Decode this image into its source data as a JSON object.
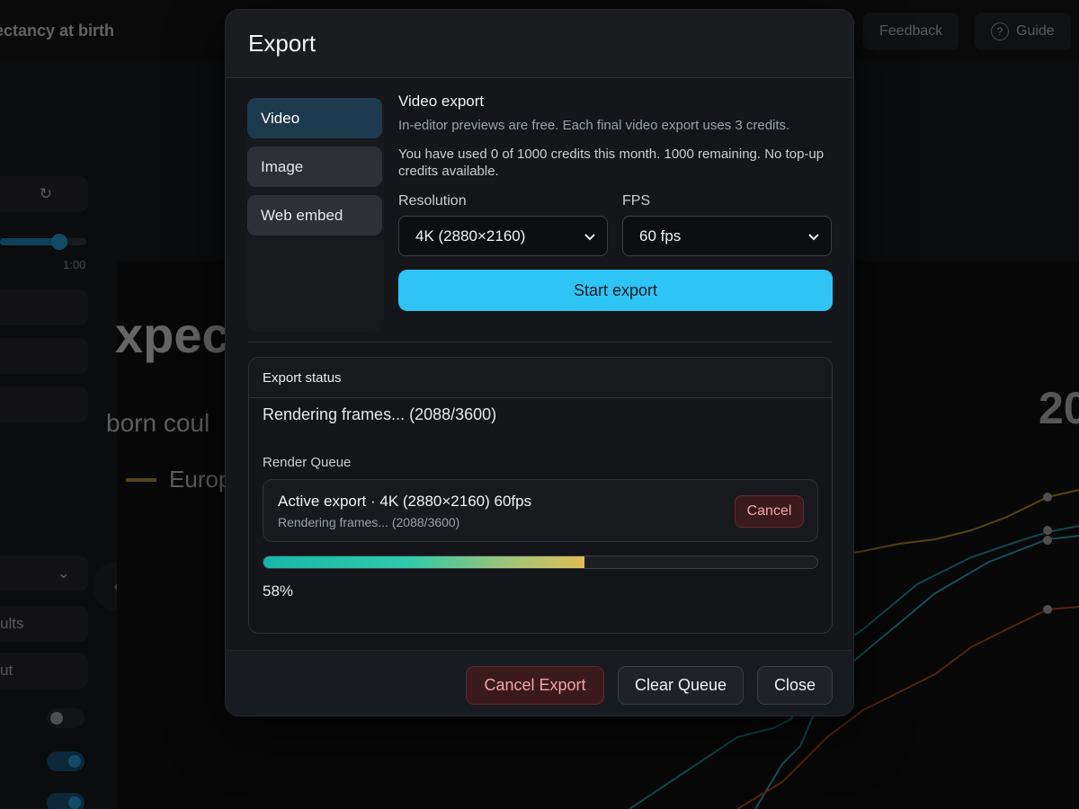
{
  "background": {
    "app_title": "ectancy at birth",
    "feedback_label": "Feedback",
    "guide_label": "Guide",
    "time_label": "1:00",
    "chart_heading": "xpec",
    "chart_subtitle": "born coul",
    "legend_label": "Europ",
    "year_label": "20",
    "field_results": "ults",
    "field_output": "ut"
  },
  "modal": {
    "title": "Export",
    "tabs": [
      {
        "label": "Video",
        "active": true
      },
      {
        "label": "Image",
        "active": false
      },
      {
        "label": "Web embed",
        "active": false
      }
    ],
    "section_title": "Video export",
    "section_desc": "In-editor previews are free. Each final video export uses 3 credits.",
    "credits_text": "You have used 0 of 1000 credits this month. 1000 remaining. No top-up credits available.",
    "resolution": {
      "label": "Resolution",
      "value": "4K (2880×2160)"
    },
    "fps": {
      "label": "FPS",
      "value": "60 fps"
    },
    "start_label": "Start export",
    "status": {
      "title": "Export status",
      "text": "Rendering frames... (2088/3600)",
      "queue_label": "Render Queue",
      "queue_item": {
        "title": "Active export · 4K (2880×2160) 60fps",
        "subtitle": "Rendering frames... (2088/3600)",
        "cancel_label": "Cancel"
      },
      "progress_fraction": 0.58,
      "progress_text": "58%"
    },
    "footer": {
      "cancel_export_label": "Cancel Export",
      "clear_queue_label": "Clear Queue",
      "close_label": "Close"
    }
  },
  "colors": {
    "accent": "#2ec4f5",
    "danger_text": "#f2a3a6",
    "active_tab": "#1d3a4f"
  }
}
